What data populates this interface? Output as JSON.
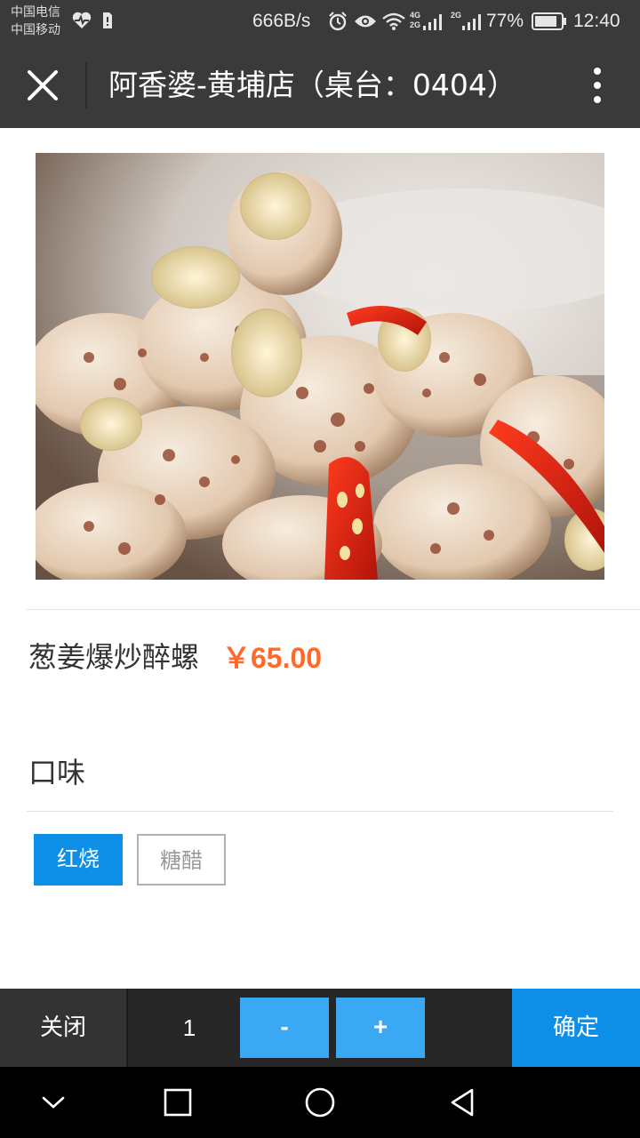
{
  "status_bar": {
    "carrier_1": "中国电信",
    "carrier_2": "中国移动",
    "net_speed": "666B/s",
    "signal_4g": "4G",
    "signal_2g": "2G",
    "battery": "77%",
    "time": "12:40",
    "icons": [
      "heart-pulse-icon",
      "sim-icon",
      "alarm-icon",
      "eye-icon",
      "wifi-icon",
      "signal-icon",
      "battery-icon"
    ]
  },
  "title_bar": {
    "title": "阿香婆-黄埔店（桌台：0404）",
    "close_icon": "close-icon",
    "more_icon": "more-vertical-icon"
  },
  "product": {
    "image": "dish-photo",
    "name": "葱姜爆炒醉螺",
    "price": "￥65.00"
  },
  "options": {
    "title": "口味",
    "items": [
      {
        "label": "红烧",
        "selected": true
      },
      {
        "label": "糖醋",
        "selected": false
      }
    ]
  },
  "bottom_bar": {
    "close_label": "关闭",
    "quantity": "1",
    "minus_label": "-",
    "plus_label": "+",
    "confirm_label": "确定"
  },
  "nav_bar": {
    "icons": [
      "back-down-icon",
      "recent-apps-icon",
      "home-icon",
      "back-icon"
    ]
  },
  "colors": {
    "accent": "#0d8fe8",
    "price": "#ff6a2a",
    "bar_dark": "#3a3a3a"
  }
}
